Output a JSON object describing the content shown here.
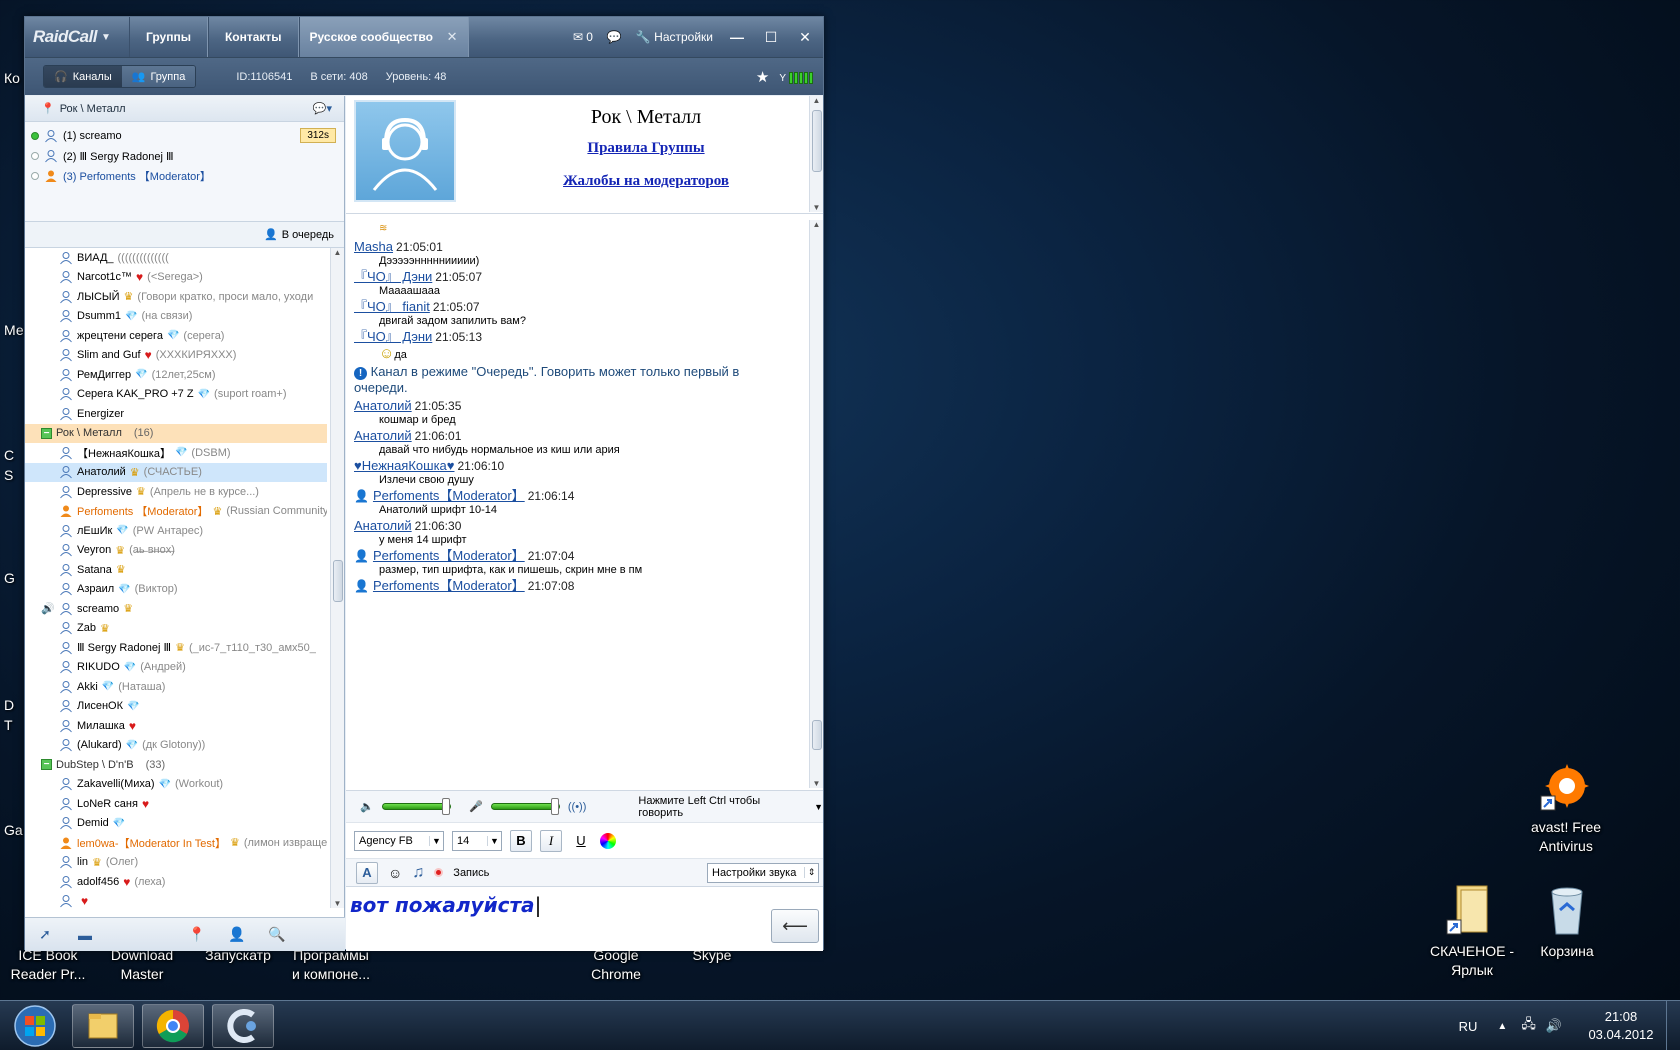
{
  "app": {
    "logo": "RaidCall",
    "tabs": [
      "Группы",
      "Контакты"
    ],
    "active_tab": "Русское сообщество",
    "mail_count": "0",
    "settings_label": "Настройки"
  },
  "subbar": {
    "btn_channels": "Каналы",
    "btn_group": "Группа",
    "id": "ID:1106541",
    "online": "В сети: 408",
    "level": "Уровень: 48"
  },
  "channel": {
    "location": "Рок \\ Металл",
    "top_users": [
      {
        "name": "(1) screamo",
        "badge": "312s"
      },
      {
        "name": "(2) Ⅲ Sergy Radonej Ⅲ"
      },
      {
        "name": "(3) Perfoments 【Moderator】"
      }
    ],
    "queue_label": "В очередь"
  },
  "tree": [
    {
      "t": "u",
      "name": "ВИАД_",
      "status": "(((((((((((((("
    },
    {
      "t": "u",
      "name": "Narcot1c™",
      "icon": "heart",
      "status": "(<Serega>)"
    },
    {
      "t": "u",
      "name": "ЛЫСЫЙ",
      "icon": "crown",
      "status": "(Говори кратко, проси мало, уходи"
    },
    {
      "t": "u",
      "name": "Dsumm1",
      "icon": "gem",
      "status": "(на связи)"
    },
    {
      "t": "u",
      "name": "жрецтени   серега",
      "icon": "gem",
      "status": "(серега)"
    },
    {
      "t": "u",
      "name": "Slim and Guf",
      "icon": "heart",
      "status": "(ХХХКИРЯХХХ)"
    },
    {
      "t": "u",
      "name": "РемДиггер",
      "icon": "gem",
      "status": "(12лет,25см)"
    },
    {
      "t": "u",
      "name": "Серега KAK_PRO +7   Z",
      "icon": "gem",
      "status": "(suport roam+)"
    },
    {
      "t": "u",
      "name": "Energizer"
    },
    {
      "t": "g",
      "name": "Рок \\ Металл",
      "count": "(16)",
      "hl": true
    },
    {
      "t": "u",
      "name": "【НежнаяКошка】",
      "icon": "gem",
      "status": "(DSBM)"
    },
    {
      "t": "u",
      "name": "Анатолий",
      "icon": "crown",
      "status": "(СЧАСТЬЕ)",
      "sel": true
    },
    {
      "t": "u",
      "name": "Depressive",
      "icon": "crown",
      "status": "(Апрель не в курсе...)"
    },
    {
      "t": "u",
      "name": "Perfoments 【Moderator】",
      "icon": "crown",
      "status": "(Russian Community Fo",
      "mod": true
    },
    {
      "t": "u",
      "name": "лЕшИк",
      "icon": "gem",
      "status": "(PW Антарес)"
    },
    {
      "t": "u",
      "name": "Veyron",
      "icon": "crown",
      "status": "(а̶ь̶ в̶н̶о̶х̶)"
    },
    {
      "t": "u",
      "name": "Satana",
      "icon": "crown"
    },
    {
      "t": "u",
      "name": "Азраил",
      "icon": "gem",
      "status": "(Виктор)"
    },
    {
      "t": "u",
      "name": "screamo",
      "icon": "crown",
      "spk": true
    },
    {
      "t": "u",
      "name": "Zab",
      "icon": "crown"
    },
    {
      "t": "u",
      "name": "Ⅲ Sergy Radonej Ⅲ",
      "icon": "crown",
      "status": "(_ис-7_т110_т30_амх50_"
    },
    {
      "t": "u",
      "name": "RIKUDO",
      "icon": "gem",
      "status": "(Андрей)"
    },
    {
      "t": "u",
      "name": "Akki",
      "icon": "gem",
      "status": "(Наташа)"
    },
    {
      "t": "u",
      "name": "ЛисенОК",
      "icon": "gem"
    },
    {
      "t": "u",
      "name": "Милашка",
      "icon": "heart"
    },
    {
      "t": "u",
      "name": "(Alukard)",
      "icon": "gem",
      "status": "(дк Glotony))"
    },
    {
      "t": "g",
      "name": "DubStep \\ D'n'B",
      "count": "(33)"
    },
    {
      "t": "u",
      "name": "Zakavelli(Миха)",
      "icon": "gem",
      "status": "(Workout)"
    },
    {
      "t": "u",
      "name": "LoNeR саня",
      "icon": "heart"
    },
    {
      "t": "u",
      "name": "Demid",
      "icon": "gem"
    },
    {
      "t": "u",
      "name": "lem0wa-【Moderator In Test】",
      "icon": "crown",
      "status": "(лимон извращен",
      "mod": true
    },
    {
      "t": "u",
      "name": "lin",
      "icon": "crown",
      "status": "(Олег)"
    },
    {
      "t": "u",
      "name": "adolf456",
      "icon": "heart",
      "status": "(леха)"
    },
    {
      "t": "u",
      "name": "",
      "icon": "heart",
      "status": ""
    }
  ],
  "info": {
    "title": "Рок \\ Металл",
    "link1": "Правила Группы",
    "link2": "Жалобы на модераторов"
  },
  "messages": [
    {
      "name": "Masha",
      "time": "21:05:01",
      "text": "Дэээээннннниииии)",
      "style": "s-purple"
    },
    {
      "name": "『ЧО』 Дэни",
      "time": "21:05:07",
      "text": "Маааашааа",
      "style": "s-black"
    },
    {
      "name": "『ЧО』 fianit",
      "time": "21:05:07",
      "text": "двигай задом запилить вам?",
      "style": "s-green"
    },
    {
      "name": "『ЧО』 Дэни",
      "time": "21:05:13",
      "text": "да",
      "style": "s-black",
      "emoji": true
    },
    {
      "system": "Канал в режиме \"Очередь\". Говорить может только первый в очереди."
    },
    {
      "name": "Анатолий",
      "time": "21:05:35",
      "text": "кошмар и бред",
      "style": "s-blue-big"
    },
    {
      "name": "Анатолий",
      "time": "21:06:01",
      "text": "давай что нибудь нормальное из киш или ария",
      "style": "s-blue-big"
    },
    {
      "name": "♥НежнаяКошка♥",
      "time": "21:06:10",
      "text": "Излечи свою душу",
      "style": "s-script"
    },
    {
      "name": "Perfoments【Moderator】",
      "time": "21:06:14",
      "text": "Анатолий  шрифт 10-14",
      "style": "s-maroon",
      "mod": true
    },
    {
      "name": "Анатолий",
      "time": "21:06:30",
      "text": "у меня 14 шрифт",
      "style": "s-blue-big"
    },
    {
      "name": "Perfoments【Moderator】",
      "time": "21:07:04",
      "text": "размер, тип шрифта, как и пишешь, скрин мне в пм",
      "style": "s-maroon",
      "mod": true
    },
    {
      "name": "Perfoments【Moderator】",
      "time": "21:07:08",
      "text": "",
      "style": "s-maroon",
      "mod": true
    }
  ],
  "controls": {
    "ptt_hint": "Нажмите Left Ctrl чтобы говорить",
    "font": "Agency FB",
    "size": "14",
    "bold": "B",
    "italic": "I",
    "underline": "U",
    "record": "Запись",
    "sound_settings": "Настройки звука",
    "input_text": "вот пожалуйста",
    "send": "⟵"
  },
  "desktop": {
    "left_labels": [
      "Ко",
      "Ме",
      "C",
      "S",
      "G",
      "D",
      "T",
      "Ga"
    ],
    "bottom_labels": [
      {
        "text": "ICE Book\nReader Pr..."
      },
      {
        "text": "Download\nMaster"
      },
      {
        "text": "Запускатр"
      },
      {
        "text": "Программы\nи компоне..."
      },
      {
        "text": "Google\nChrome"
      },
      {
        "text": "Skype"
      }
    ],
    "icons": [
      {
        "label": "avast! Free Antivirus"
      },
      {
        "label": "СКАЧЕНОЕ - Ярлык"
      },
      {
        "label": "Корзина"
      }
    ]
  },
  "taskbar": {
    "lang": "RU",
    "time": "21:08",
    "date": "03.04.2012"
  }
}
